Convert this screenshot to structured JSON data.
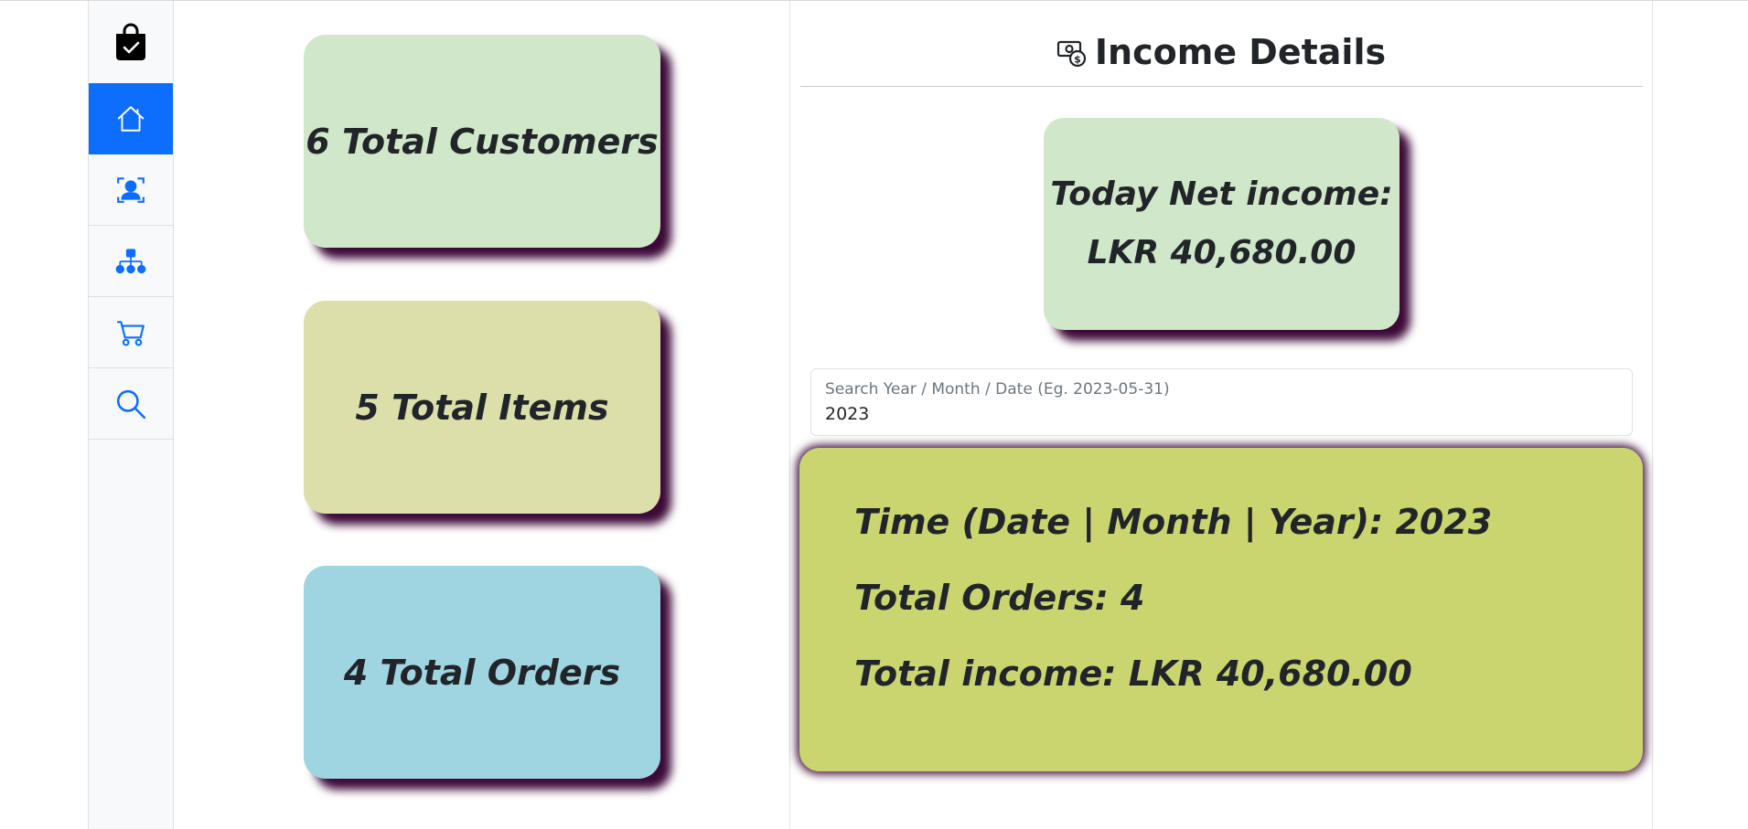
{
  "sidebar": {
    "items": [
      {
        "name": "home",
        "icon": "home-icon",
        "active": true
      },
      {
        "name": "customers",
        "icon": "person-badge-icon",
        "active": false
      },
      {
        "name": "items",
        "icon": "diagram-icon",
        "active": false
      },
      {
        "name": "orders",
        "icon": "cart-icon",
        "active": false
      },
      {
        "name": "search",
        "icon": "search-icon",
        "active": false
      }
    ],
    "brand_icon": "shopping-bag-check-icon"
  },
  "stats": {
    "customers": "6 Total Customers",
    "items": "5 Total Items",
    "orders": "4 Total Orders"
  },
  "income": {
    "title": "Income Details",
    "title_icon": "cash-coin-icon",
    "today_label": "Today Net income:",
    "today_value": "LKR 40,680.00",
    "search_label": "Search Year / Month / Date (Eg. 2023-05-31)",
    "search_value": "2023",
    "summary": {
      "time": "Time (Date | Month | Year): 2023",
      "orders": "Total Orders: 4",
      "income": "Total income: LKR 40,680.00"
    }
  },
  "colors": {
    "accent": "#0d6efd",
    "card_green": "#d1e7c9",
    "card_yellow": "#dcdfaa",
    "card_blue": "#9fd5e1",
    "card_lime": "#cad56f",
    "shadow": "#3d0a38"
  }
}
